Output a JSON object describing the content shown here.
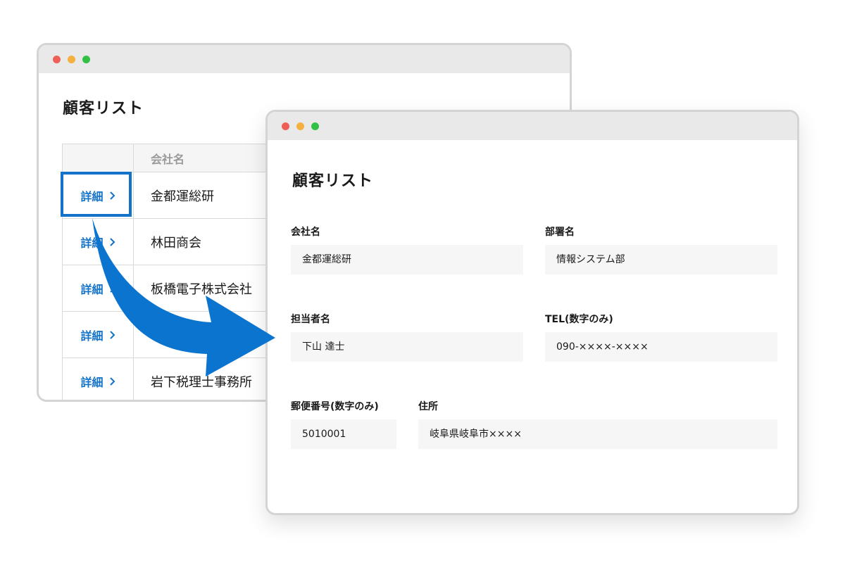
{
  "list_window": {
    "title": "顧客リスト",
    "table": {
      "header_company": "会社名",
      "detail_label": "詳細",
      "rows": [
        {
          "company": "金都運総研"
        },
        {
          "company": "林田商会"
        },
        {
          "company": "板橋電子株式会社"
        },
        {
          "company": ""
        },
        {
          "company": "岩下税理士事務所"
        }
      ]
    }
  },
  "detail_window": {
    "title": "顧客リスト",
    "fields": {
      "company": {
        "label": "会社名",
        "value": "金都運総研"
      },
      "department": {
        "label": "部署名",
        "value": "情報システム部"
      },
      "contact": {
        "label": "担当者名",
        "value": "下山 達士"
      },
      "tel": {
        "label": "TEL(数字のみ)",
        "value": "090-××××-××××"
      },
      "postal": {
        "label": "郵便番号(数字のみ)",
        "value": "5010001"
      },
      "address": {
        "label": "住所",
        "value": "岐阜県岐阜市××××"
      }
    }
  },
  "colors": {
    "accent": "#1473c8",
    "arrow": "#0b74cf",
    "titlebar": "#e9e9e9",
    "field_bg": "#f6f6f6"
  },
  "icons": {
    "detail_chevron": "chevron-right-icon",
    "flow_arrow": "curved-arrow-icon"
  }
}
